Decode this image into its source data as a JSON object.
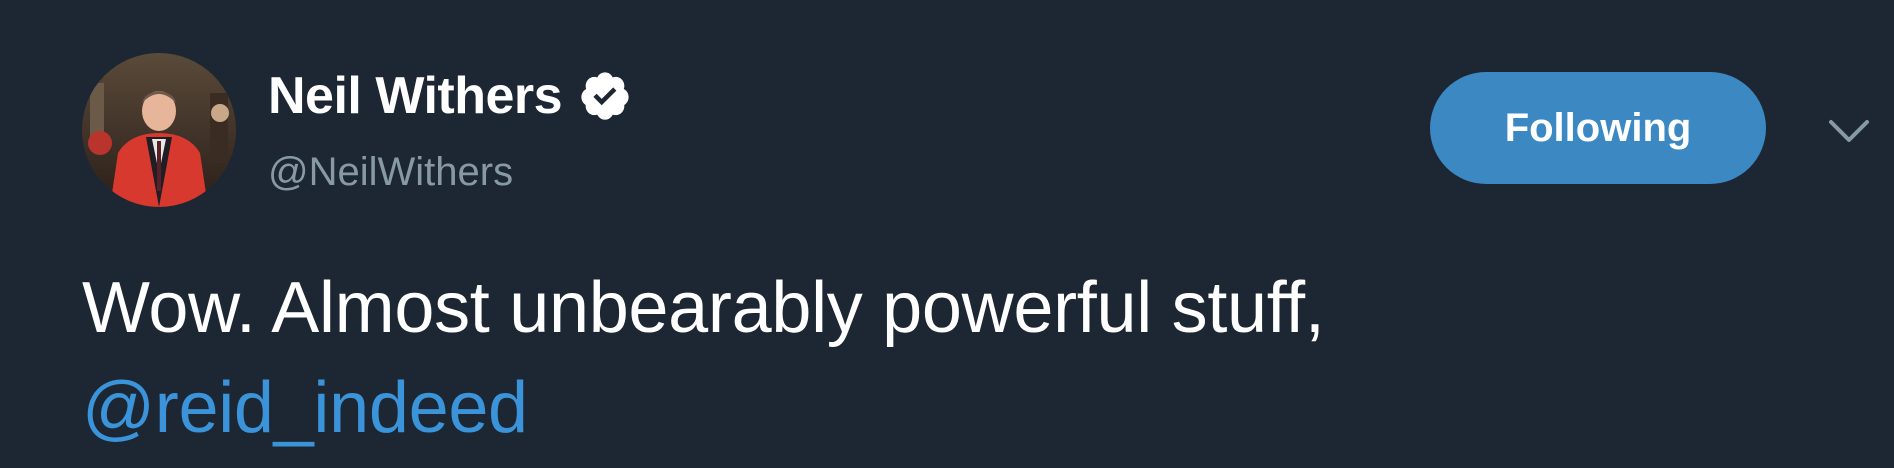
{
  "user": {
    "display_name": "Neil Withers",
    "handle": "@NeilWithers",
    "verified": true
  },
  "follow_button": {
    "label": "Following"
  },
  "tweet": {
    "text": "Wow. Almost unbearably powerful stuff,",
    "mention": "@reid_indeed"
  },
  "icons": {
    "verified": "verified-badge-icon",
    "menu": "chevron-down-icon"
  },
  "colors": {
    "background": "#1c2733",
    "button": "#3b88c3",
    "link": "#3b94d9",
    "secondary_text": "#8899a6"
  }
}
